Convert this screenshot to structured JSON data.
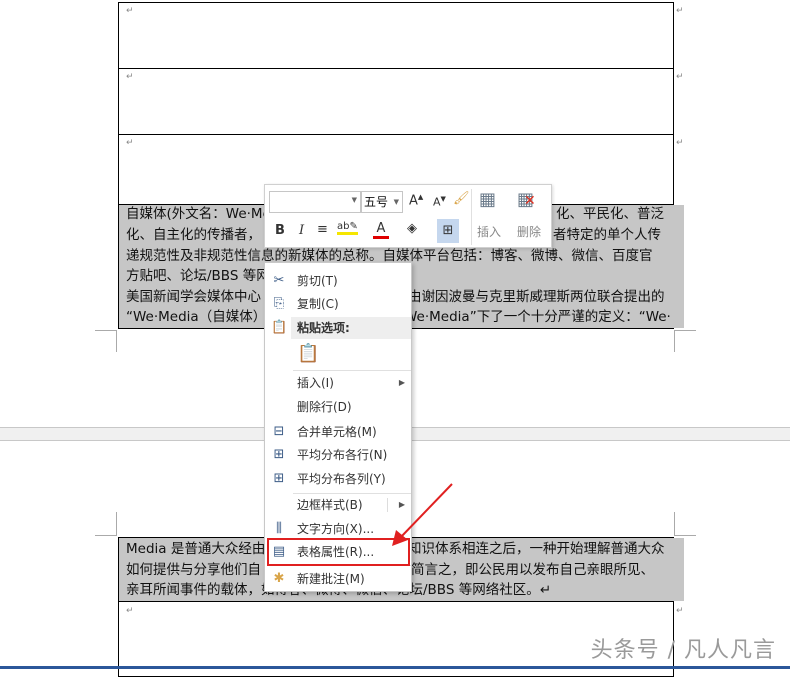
{
  "page1": {
    "lines": [
      [
        "自媒体(外文名：We·Me",
        "化、平民化、普泛"
      ],
      [
        "化、自主化的传播者，",
        "者特定的单个人传"
      ],
      [
        "递规范性及非规范性信息的新媒体的总称。自媒体平台包括：博客、微博、微信、百度官",
        ""
      ],
      [
        "方贴吧、论坛/BBS 等网",
        ""
      ],
      [
        "美国新闻学会媒体中心",
        "由谢因波曼与克里斯威理斯两位联合提出的"
      ],
      [
        "“We·Media（自媒体）",
        "We·Media”下了一个十分严谨的定义：“We·"
      ]
    ]
  },
  "page2": {
    "lines": [
      [
        "Media 是普通大众经由",
        "知识体系相连之后，一种开始理解普通大众"
      ],
      [
        "如何提供与分享他们自",
        "”简言之，即公民用以发布自己亲眼所见、"
      ],
      [
        "亲耳所闻事件的载体，如博客、微博、微信、论坛/BBS 等网络社区。↵",
        ""
      ]
    ]
  },
  "para_mark": "↵",
  "mini_toolbar": {
    "font_name": "",
    "font_size": "五号",
    "insert_label": "插入",
    "delete_label": "删除",
    "bold": "B",
    "italic": "I"
  },
  "context_menu": {
    "items": [
      {
        "label": "剪切(T)",
        "icon": "scissors-icon"
      },
      {
        "label": "复制(C)",
        "icon": "copy-icon"
      },
      {
        "label": "粘贴选项:",
        "icon": "paste-icon"
      },
      {
        "label": "插入(I)",
        "icon": ""
      },
      {
        "label": "删除行(D)",
        "icon": ""
      },
      {
        "label": "合并单元格(M)",
        "icon": "merge-cells-icon"
      },
      {
        "label": "平均分布各行(N)",
        "icon": "distribute-rows-icon"
      },
      {
        "label": "平均分布各列(Y)",
        "icon": "distribute-columns-icon"
      },
      {
        "label": "边框样式(B)",
        "icon": ""
      },
      {
        "label": "文字方向(X)...",
        "icon": "text-direction-icon"
      },
      {
        "label": "表格属性(R)...",
        "icon": "table-properties-icon"
      },
      {
        "label": "新建批注(M)",
        "icon": "new-comment-icon"
      }
    ],
    "highlighted": "表格属性(R)..."
  },
  "watermark": "头条号 / 凡人凡言",
  "colors": {
    "highlight": "#e02020",
    "selection": "#c6c6c6",
    "accent": "#2b579a"
  }
}
